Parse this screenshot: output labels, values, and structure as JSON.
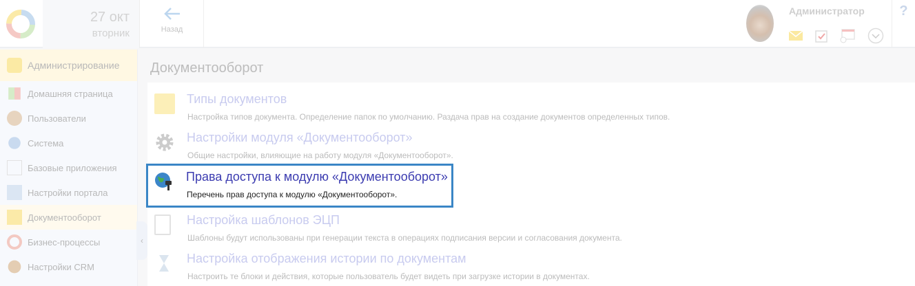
{
  "header": {
    "date": "27 окт",
    "weekday": "вторник",
    "back_label": "Назад",
    "user_name": "Администратор",
    "help": "?"
  },
  "sidebar": {
    "section": "Администрирование",
    "items": [
      {
        "label": "Домашняя страница"
      },
      {
        "label": "Пользователи"
      },
      {
        "label": "Система"
      },
      {
        "label": "Базовые приложения"
      },
      {
        "label": "Настройки портала"
      },
      {
        "label": "Документооборот"
      },
      {
        "label": "Бизнес-процессы"
      },
      {
        "label": "Настройки CRM"
      }
    ]
  },
  "main": {
    "title": "Документооборот",
    "items": [
      {
        "title": "Типы документов",
        "desc": "Настройка типов документа. Определение папок по умолчанию. Раздача прав на создание документов определенных типов."
      },
      {
        "title": "Настройки модуля «Документооборот»",
        "desc": "Общие настройки, влияющие на работу модуля «Документооборот»."
      },
      {
        "title": "Права доступа к модулю «Документооборот»",
        "desc": "Перечень прав доступа к модулю «Документооборот»."
      },
      {
        "title": "Настройка шаблонов ЭЦП",
        "desc": "Шаблоны будут использованы при генерации текста в операциях подписания версии и согласования документа."
      },
      {
        "title": "Настройка отображения истории по документам",
        "desc": "Настроить те блоки и действия, которые пользователь будет видеть при загрузке истории в документах."
      }
    ]
  },
  "colors": {
    "highlight": "#3a86c6",
    "link": "#3b3bb0"
  }
}
